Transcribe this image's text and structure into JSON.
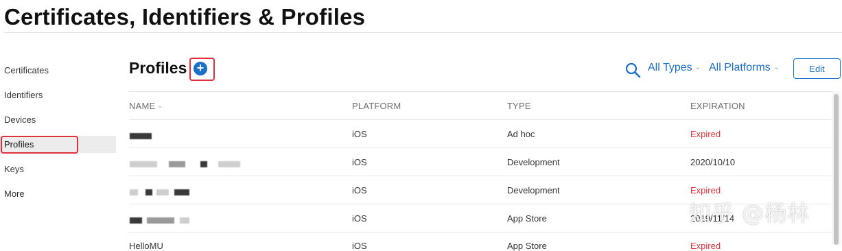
{
  "page": {
    "title": "Certificates, Identifiers & Profiles"
  },
  "sidebar": {
    "items": [
      {
        "label": "Certificates"
      },
      {
        "label": "Identifiers"
      },
      {
        "label": "Devices"
      },
      {
        "label": "Profiles",
        "active": true
      },
      {
        "label": "Keys"
      },
      {
        "label": "More"
      }
    ]
  },
  "section": {
    "title": "Profiles",
    "add_label": "+",
    "filters": {
      "types": "All Types",
      "platforms": "All Platforms"
    },
    "edit_label": "Edit"
  },
  "table": {
    "columns": [
      "NAME",
      "PLATFORM",
      "TYPE",
      "EXPIRATION"
    ],
    "rows": [
      {
        "name": "",
        "platform": "iOS",
        "type": "Ad hoc",
        "expiration": "Expired",
        "expired": true
      },
      {
        "name": "",
        "platform": "iOS",
        "type": "Development",
        "expiration": "2020/10/10",
        "expired": false
      },
      {
        "name": "",
        "platform": "iOS",
        "type": "Development",
        "expiration": "Expired",
        "expired": true
      },
      {
        "name": "",
        "platform": "iOS",
        "type": "App Store",
        "expiration": "2019/11/14",
        "expired": false
      },
      {
        "name": "HelloMU",
        "platform": "iOS",
        "type": "App Store",
        "expiration": "Expired",
        "expired": true
      }
    ]
  },
  "colors": {
    "accent": "#1a6fc9",
    "expired": "#e0303a",
    "highlight": "#e02f3a"
  },
  "watermark": "知乎 @杨林"
}
